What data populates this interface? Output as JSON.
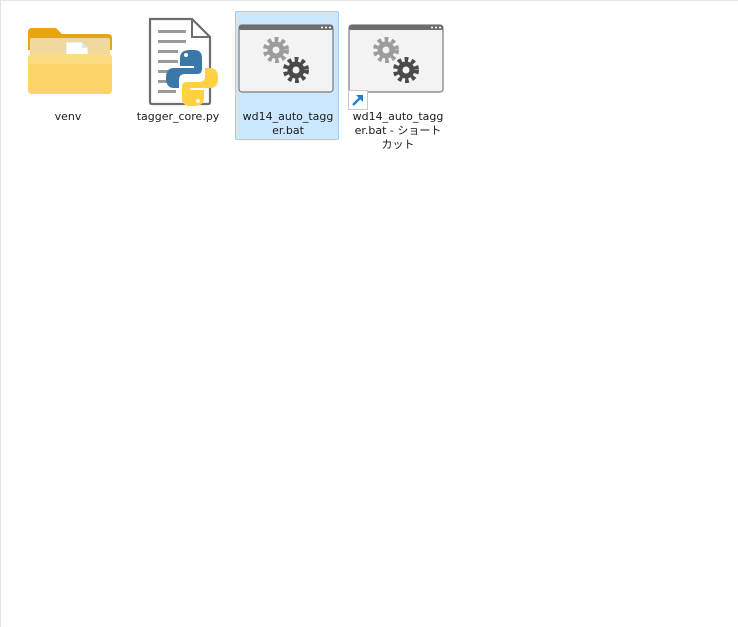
{
  "files": [
    {
      "name": "venv",
      "type": "folder",
      "icon": "folder-icon",
      "selected": false
    },
    {
      "name": "tagger_core.py",
      "type": "python-file",
      "icon": "python-file-icon",
      "selected": false
    },
    {
      "name": "wd14_auto_tagger.bat",
      "type": "batch-file",
      "icon": "batch-file-icon",
      "selected": true
    },
    {
      "name": "wd14_auto_tagger.bat - ショートカット",
      "type": "shortcut",
      "icon": "shortcut-icon",
      "selected": false
    }
  ],
  "colors": {
    "selection_background": "#cce8ff",
    "selection_border": "#99d1ff",
    "folder_yellow": "#f8c93e",
    "shortcut_arrow": "#1b7fd6"
  }
}
